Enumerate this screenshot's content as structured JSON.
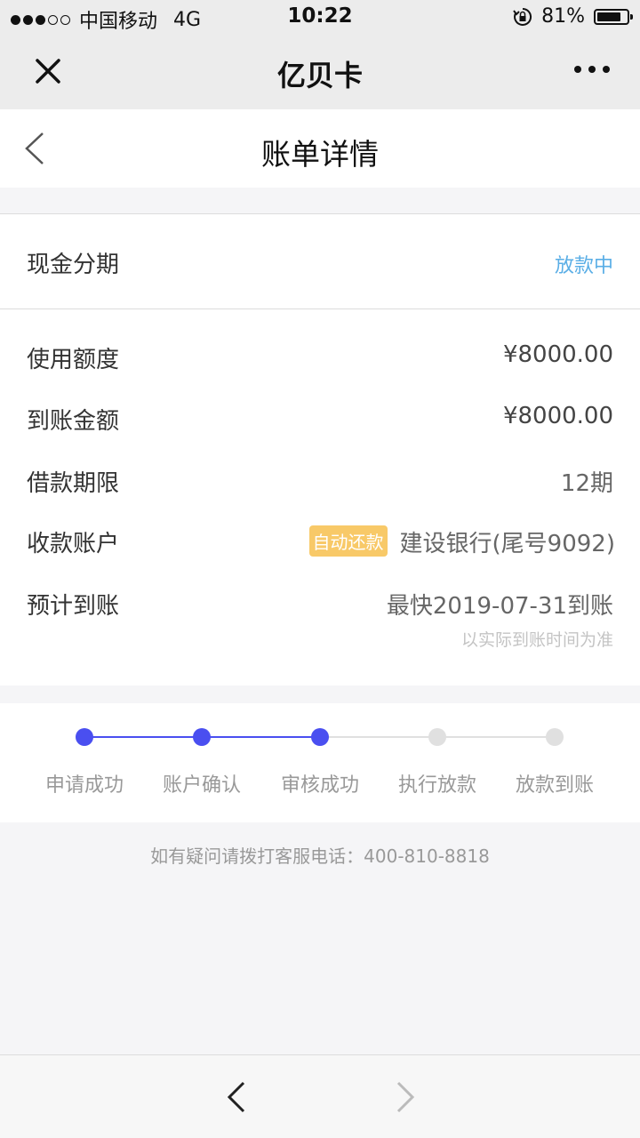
{
  "status_bar": {
    "carrier": "中国移动",
    "network": "4G",
    "time": "10:22",
    "battery": "81%",
    "battery_level": 0.81
  },
  "wx_nav": {
    "title": "亿贝卡"
  },
  "page": {
    "title": "账单详情"
  },
  "loan": {
    "type": "现金分期",
    "status": "放款中",
    "status_color": "#5aaee6"
  },
  "details": [
    {
      "key": "使用额度",
      "value": "¥8000.00"
    },
    {
      "key": "到账金额",
      "value": "¥8000.00"
    },
    {
      "key": "借款期限",
      "value": "12期"
    },
    {
      "key": "收款账户",
      "badge": "自动还款",
      "value": "建设银行(尾号9092)"
    },
    {
      "key": "预计到账",
      "value": "最快2019-07-31到账",
      "note": "以实际到账时间为准"
    }
  ],
  "progress": {
    "steps": [
      "申请成功",
      "账户确认",
      "审核成功",
      "执行放款",
      "放款到账"
    ],
    "completed": 3,
    "active_color": "#4a4ff0",
    "inactive_color": "#e0e0e0"
  },
  "hotline": "如有疑问请拨打客服电话：400-810-8818"
}
